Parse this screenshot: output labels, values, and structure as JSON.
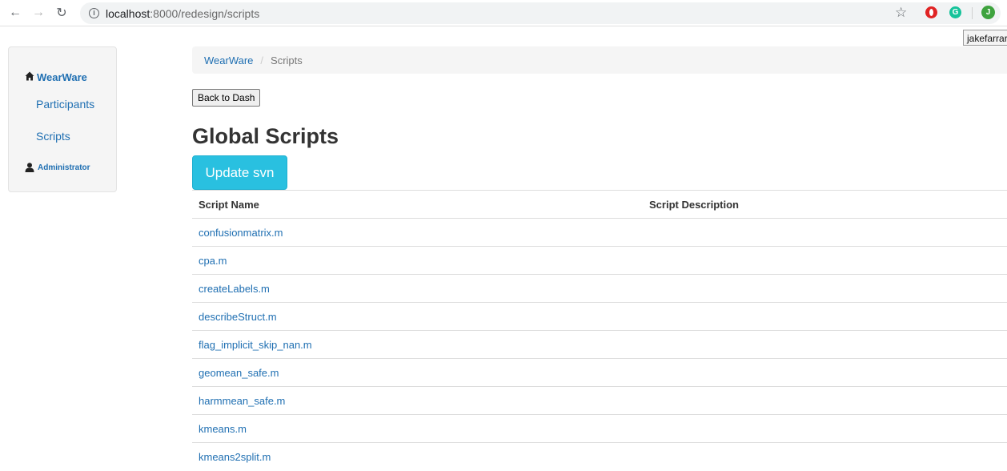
{
  "browser": {
    "url_host": "localhost",
    "url_path": ":8000/redesign/scripts",
    "profile_initial": "J",
    "grammarly_glyph": "G",
    "tooltip": "jakefarrar"
  },
  "sidebar": {
    "brand": "WearWare",
    "items": [
      {
        "label": "Participants"
      },
      {
        "label": "Scripts"
      }
    ],
    "admin_label": "Administrator"
  },
  "breadcrumb": {
    "home": "WearWare",
    "separator": "/",
    "current": "Scripts"
  },
  "actions": {
    "back_label": "Back to Dash",
    "update_label": "Update svn"
  },
  "page_title": "Global Scripts",
  "table": {
    "headers": [
      "Script Name",
      "Script Description"
    ],
    "rows": [
      {
        "name": "confusionmatrix.m",
        "description": ""
      },
      {
        "name": "cpa.m",
        "description": ""
      },
      {
        "name": "createLabels.m",
        "description": ""
      },
      {
        "name": "describeStruct.m",
        "description": ""
      },
      {
        "name": "flag_implicit_skip_nan.m",
        "description": ""
      },
      {
        "name": "geomean_safe.m",
        "description": ""
      },
      {
        "name": "harmmean_safe.m",
        "description": ""
      },
      {
        "name": "kmeans.m",
        "description": ""
      },
      {
        "name": "kmeans2split.m",
        "description": ""
      }
    ]
  },
  "colors": {
    "link": "#1f6fb2",
    "info_button": "#29c0e0",
    "panel_bg": "#f5f5f5",
    "border": "#dddddd"
  }
}
